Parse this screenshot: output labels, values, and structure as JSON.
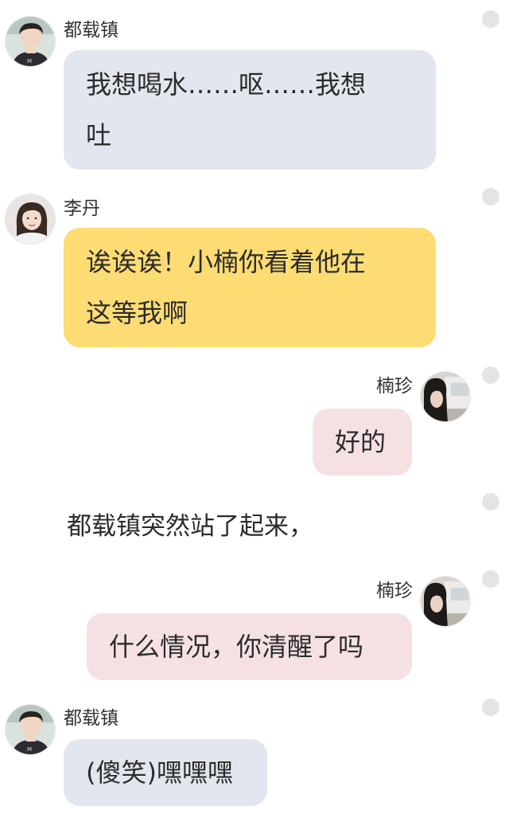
{
  "colors": {
    "bubble_blue": "#e2e7ef",
    "bubble_yellow": "#fedc74",
    "bubble_pink": "#f5e1e3",
    "dot": "#e4e4e4"
  },
  "messages": [
    {
      "sender": "都载镇",
      "side": "left",
      "color": "blue",
      "text_lines": [
        "我想喝水……呕……我想",
        "吐"
      ]
    },
    {
      "sender": "李丹",
      "side": "left",
      "color": "yellow",
      "text_lines": [
        "诶诶诶！小楠你看着他在",
        "这等我啊"
      ]
    },
    {
      "sender": "楠珍",
      "side": "right",
      "color": "pink",
      "text": "好的"
    },
    {
      "narration": "都载镇突然站了起来，"
    },
    {
      "sender": "楠珍",
      "side": "right",
      "color": "pink",
      "text": "什么情况，你清醒了吗"
    },
    {
      "sender": "都载镇",
      "side": "left",
      "color": "blue",
      "text": "(傻笑)嘿嘿嘿"
    }
  ]
}
